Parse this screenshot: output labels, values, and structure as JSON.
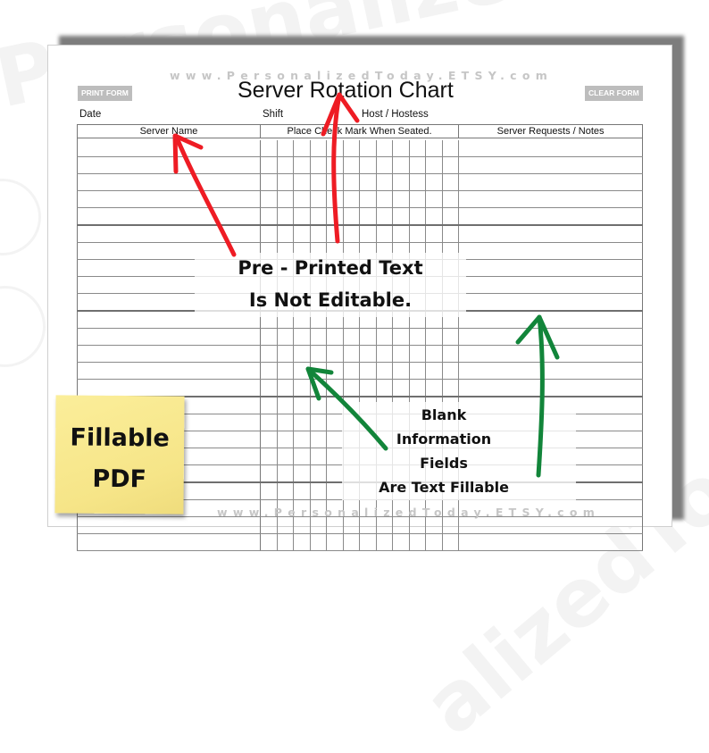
{
  "background_watermark": {
    "text_top": "Personalized",
    "text_bottom": "alizedToday"
  },
  "form": {
    "watermark_top": "www.PersonalizedToday.ETSY.com",
    "watermark_bottom": "www.PersonalizedToday.ETSY.com",
    "print_button": "PRINT FORM",
    "clear_button": "CLEAR FORM",
    "title": "Server Rotation Chart",
    "labels": {
      "date": "Date",
      "shift": "Shift",
      "host": "Host / Hostess"
    },
    "table": {
      "headers": [
        "Server Name",
        "Place Check Mark When Seated.",
        "Server Requests / Notes"
      ],
      "check_columns": 12,
      "row_count": 24
    }
  },
  "callouts": {
    "not_editable": [
      "Pre - Printed Text",
      "Is Not Editable."
    ],
    "fillable": [
      "Blank",
      "Information",
      "Fields",
      "Are Text Fillable"
    ]
  },
  "sticky_note": {
    "line1": "Fillable",
    "line2": "PDF"
  },
  "colors": {
    "red_arrow": "#ee1c24",
    "green_arrow": "#12853a",
    "sticky": "#f8e98f",
    "button_gray": "#bdbdbd"
  }
}
